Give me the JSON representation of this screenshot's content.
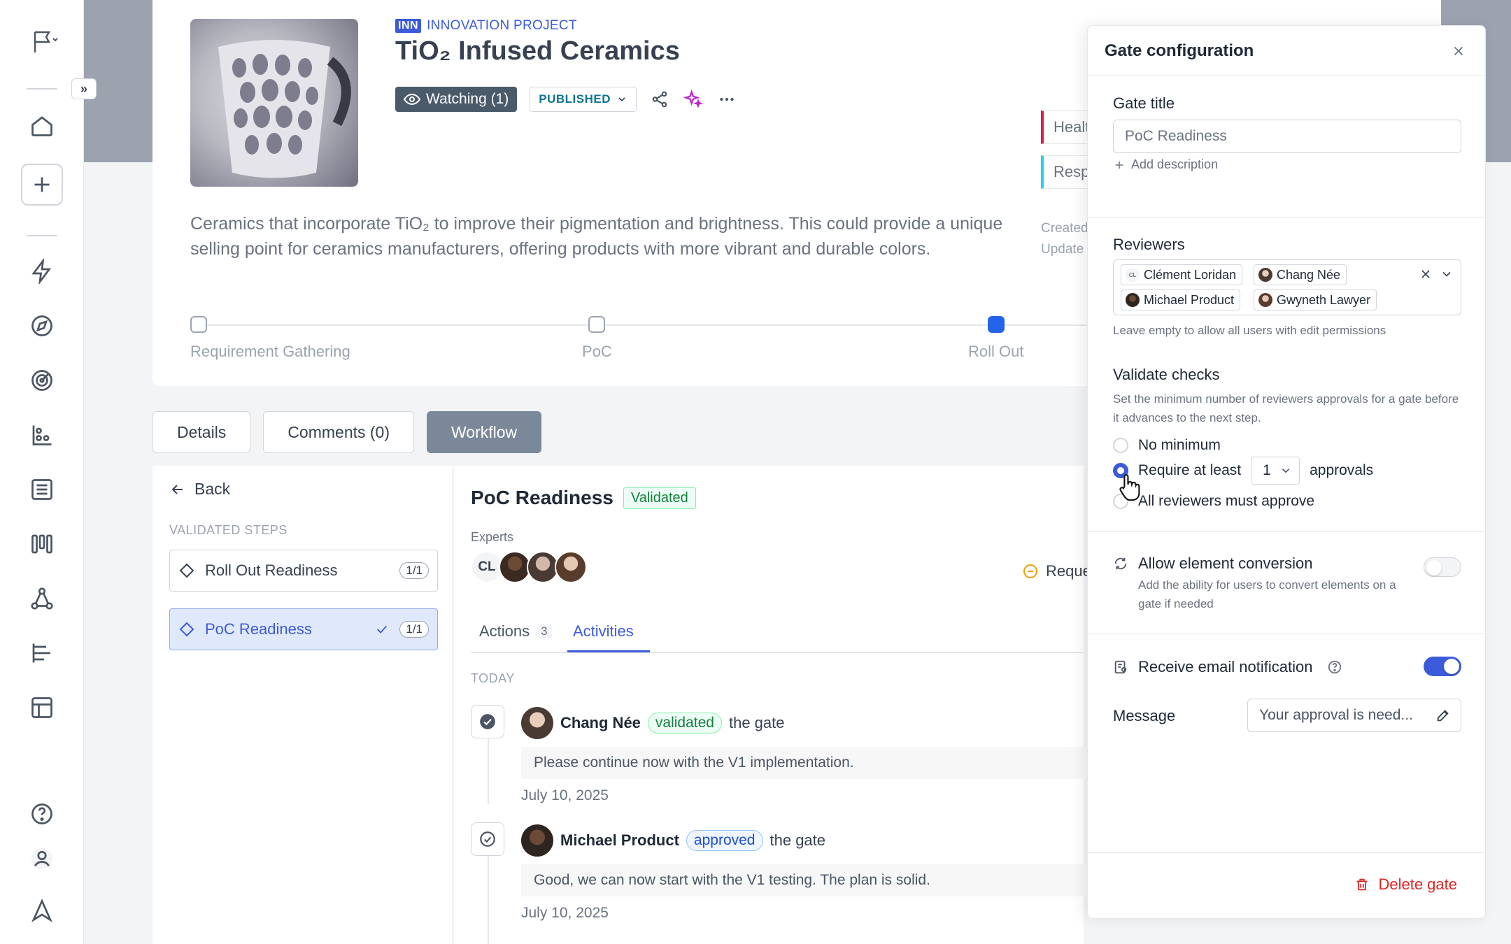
{
  "project": {
    "type_code": "INN",
    "type_label": "INNOVATION PROJECT",
    "title": "TiO₂ Infused Ceramics",
    "watching_label": "Watching (1)",
    "status_label": "PUBLISHED",
    "description": "Ceramics that incorporate TiO₂ to improve their pigmentation and brightness. This could provide a unique selling point for ceramics manufacturers, offering products with more vibrant and durable colors.",
    "side_tags": [
      "Healt",
      "Resp"
    ],
    "meta_created": "Created",
    "meta_updated": "Update"
  },
  "stepper": [
    {
      "label": "Requirement Gathering",
      "active": false
    },
    {
      "label": "PoC",
      "active": false
    },
    {
      "label": "Roll Out",
      "active": true
    }
  ],
  "tabs": [
    {
      "label": "Details",
      "active": false
    },
    {
      "label": "Comments (0)",
      "active": false
    },
    {
      "label": "Workflow",
      "active": true
    }
  ],
  "workflow": {
    "back_label": "Back",
    "validated_steps_label": "VALIDATED STEPS",
    "steps": [
      {
        "label": "Roll Out Readiness",
        "count": "1/1",
        "selected": false
      },
      {
        "label": "PoC Readiness",
        "count": "1/1",
        "selected": true
      }
    ],
    "gate": {
      "name": "PoC Readiness",
      "status": "Validated",
      "experts_label": "Experts",
      "experts_initials": "CL",
      "request_label": "Reque"
    },
    "subtabs": {
      "actions_label": "Actions",
      "actions_count": "3",
      "activities_label": "Activities"
    },
    "today_label": "TODAY",
    "activities": [
      {
        "user": "Chang Née",
        "action": "validated",
        "suffix": "the gate",
        "comment": "Please continue now with the V1 implementation.",
        "date": "July 10, 2025"
      },
      {
        "user": "Michael Product",
        "action": "approved",
        "suffix": "the gate",
        "comment": "Good, we can now start with the V1 testing. The plan is solid.",
        "date": "July 10, 2025"
      }
    ]
  },
  "drawer": {
    "title": "Gate configuration",
    "gate_title_label": "Gate title",
    "gate_title_value": "PoC Readiness",
    "add_description": "Add description",
    "reviewers_label": "Reviewers",
    "reviewers": [
      {
        "name": "Clément Loridan",
        "initials": "CL"
      },
      {
        "name": "Chang Née"
      },
      {
        "name": "Michael Product"
      },
      {
        "name": "Gwyneth Lawyer"
      }
    ],
    "reviewers_help": "Leave empty to allow all users with edit permissions",
    "validate_label": "Validate checks",
    "validate_help": "Set the minimum number of reviewers approvals for a gate before it advances to the next step.",
    "option_no_min": "No minimum",
    "option_require": "Require at least",
    "require_value": "1",
    "approvals_suffix": "approvals",
    "option_all": "All reviewers must approve",
    "selected_option": "require",
    "conversion_label": "Allow element conversion",
    "conversion_help": "Add the ability for users to convert elements on a gate if needed",
    "conversion_on": false,
    "email_label": "Receive email notification",
    "email_on": true,
    "message_label": "Message",
    "message_value": "Your approval is need...",
    "delete_label": "Delete gate"
  },
  "colors": {
    "accent": "#3b5bdb",
    "danger": "#dc2626",
    "success": "#15803d"
  }
}
